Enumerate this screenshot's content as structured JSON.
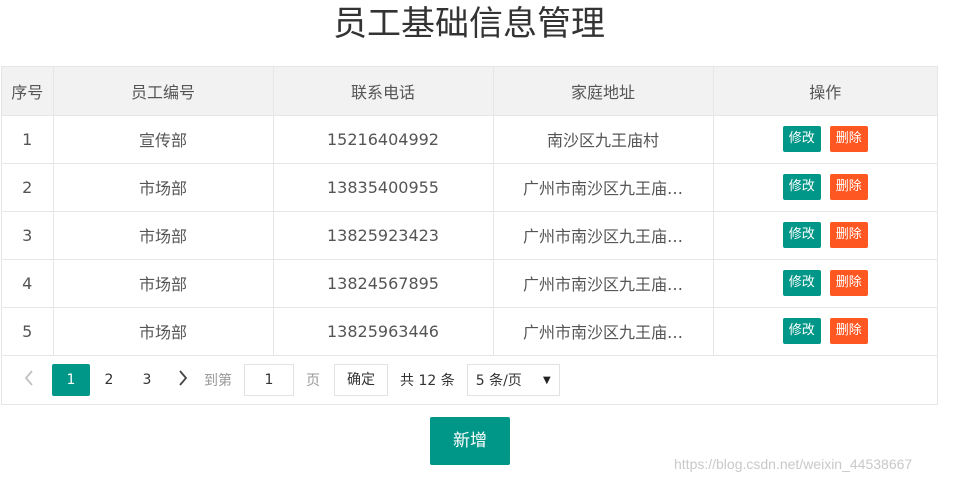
{
  "page": {
    "title": "员工基础信息管理"
  },
  "table": {
    "headers": [
      "序号",
      "员工编号",
      "联系电话",
      "家庭地址",
      "操作"
    ],
    "rows": [
      {
        "idx": "1",
        "num": "宣传部",
        "tel": "15216404992",
        "addr": "南沙区九王庙村"
      },
      {
        "idx": "2",
        "num": "市场部",
        "tel": "13835400955",
        "addr": "广州市南沙区九王庙…"
      },
      {
        "idx": "3",
        "num": "市场部",
        "tel": "13825923423",
        "addr": "广州市南沙区九王庙…"
      },
      {
        "idx": "4",
        "num": "市场部",
        "tel": "13824567895",
        "addr": "广州市南沙区九王庙…"
      },
      {
        "idx": "5",
        "num": "市场部",
        "tel": "13825963446",
        "addr": "广州市南沙区九王庙…"
      }
    ],
    "edit_label": "修改",
    "delete_label": "删除"
  },
  "pager": {
    "prev_icon": "chevron-left-icon",
    "next_icon": "chevron-right-icon",
    "pages": [
      "1",
      "2",
      "3"
    ],
    "current": "1",
    "goto_label": "到第",
    "goto_value": "1",
    "page_suffix": "页",
    "confirm_label": "确定",
    "total_label": "共 12 条",
    "page_size": "5 条/页"
  },
  "actions": {
    "add_label": "新增"
  },
  "watermark": "https://blog.csdn.net/weixin_44538667",
  "colors": {
    "primary": "#009688",
    "danger": "#ff5722",
    "header_bg": "#f2f2f2"
  }
}
